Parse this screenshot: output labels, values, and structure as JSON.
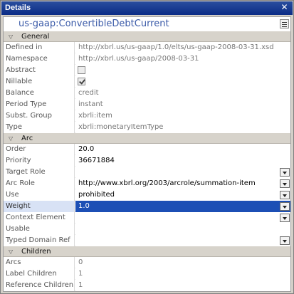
{
  "window": {
    "title": "Details",
    "close_glyph": "✕"
  },
  "heading": {
    "element_name": "us-gaap:ConvertibleDebtCurrent",
    "menu_icon": "list-menu-icon"
  },
  "sections": {
    "general": {
      "label": "General",
      "collapse_glyph": "▽"
    },
    "arc": {
      "label": "Arc",
      "collapse_glyph": "▽"
    },
    "children": {
      "label": "Children",
      "collapse_glyph": "▽"
    }
  },
  "general_rows": [
    {
      "key": "Defined in",
      "value": "http://xbrl.us/us-gaap/1.0/elts/us-gaap-2008-03-31.xsd"
    },
    {
      "key": "Namespace",
      "value": "http://xbrl.us/us-gaap/2008-03-31"
    },
    {
      "key": "Abstract",
      "checked": false
    },
    {
      "key": "Nillable",
      "checked": true
    },
    {
      "key": "Balance",
      "value": "credit"
    },
    {
      "key": "Period Type",
      "value": "instant"
    },
    {
      "key": "Subst. Group",
      "value": "xbrli:item"
    },
    {
      "key": "Type",
      "value": "xbrli:monetaryItemType"
    }
  ],
  "arc_rows": [
    {
      "key": "Order",
      "value": "20.0"
    },
    {
      "key": "Priority",
      "value": "36671884"
    },
    {
      "key": "Target Role",
      "value": ""
    },
    {
      "key": "Arc Role",
      "value": "http://www.xbrl.org/2003/arcrole/summation-item"
    },
    {
      "key": "Use",
      "value": "prohibited"
    },
    {
      "key": "Weight",
      "value": "1.0"
    },
    {
      "key": "Context Element",
      "value": ""
    },
    {
      "key": "Usable",
      "value": ""
    },
    {
      "key": "Typed Domain Ref",
      "value": ""
    }
  ],
  "children_rows": [
    {
      "key": "Arcs",
      "value": "0"
    },
    {
      "key": "Label Children",
      "value": "1"
    },
    {
      "key": "Reference Children",
      "value": "1"
    }
  ],
  "colors": {
    "title_bar": "#0b2c86",
    "heading_text": "#3a5aa8",
    "selected_row": "#1c4fb5"
  }
}
